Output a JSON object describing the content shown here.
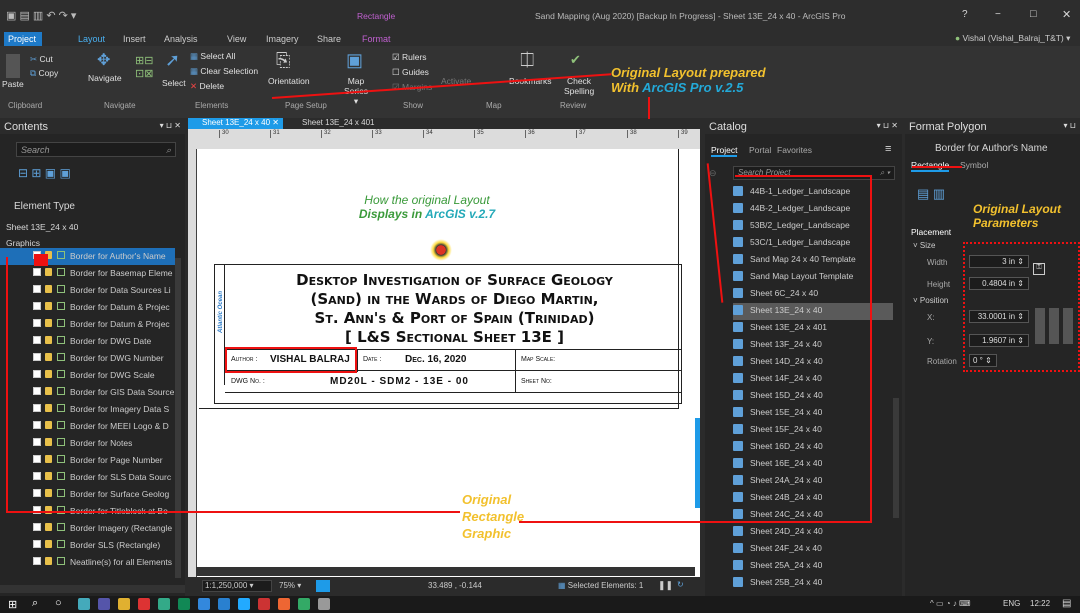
{
  "window": {
    "title_center": "Rectangle",
    "title": "Sand Mapping (Aug 2020) [Backup In Progress] - Sheet 13E_24 x 40 - ArcGIS Pro",
    "controls": [
      "?",
      "−",
      "□",
      "✕"
    ]
  },
  "tabs": [
    "Project",
    "Layout",
    "Insert",
    "Analysis",
    "View",
    "Imagery",
    "Share",
    "Format"
  ],
  "user": "Vishal (Vishal_Balraj_T&T) ▾",
  "ribbon": {
    "clipboard": {
      "paste": "Paste",
      "cut": "Cut",
      "copy": "Copy",
      "label": "Clipboard"
    },
    "navigate": {
      "navigate": "Navigate",
      "label": "Navigate"
    },
    "elements": {
      "select": "Select",
      "select_all": "Select All",
      "clear_selection": "Clear Selection",
      "delete": "Delete",
      "label": "Elements"
    },
    "page_setup": {
      "orientation": "Orientation",
      "map_series": "Map Series ▾",
      "label": "Page Setup"
    },
    "show": {
      "rulers": "Rulers",
      "guides": "Guides",
      "margins": "Margins",
      "label": "Show"
    },
    "map": {
      "activate": "Activate",
      "bookmarks": "Bookmarks",
      "label": "Map"
    },
    "review": {
      "check_spelling": "Check Spelling",
      "label": "Review"
    }
  },
  "annotations": {
    "top": "Original Layout prepared",
    "top2_prefix": "With ",
    "top2_app": "ArcGIS Pro v.2.5",
    "params1": "Original Layout",
    "params2": "Parameters",
    "rect1": "Original",
    "rect2": "Rectangle",
    "rect3": "Graphic"
  },
  "contents": {
    "title": "Contents",
    "search": "Search",
    "element_type": "Element Type",
    "sheet": "Sheet 13E_24 x 40",
    "graphics": "Graphics",
    "items": [
      "Border for Author's Name",
      "Border for Basemap Eleme",
      "Border for Data Sources Li",
      "Border for Datum & Projec",
      "Border for Datum & Projec",
      "Border for DWG Date",
      "Border for DWG Number",
      "Border for DWG Scale",
      "Border for GIS Data Source",
      "Border for Imagery Data S",
      "Border for MEEI Logo & D",
      "Border for Notes",
      "Border for Page Number",
      "Border for SLS Data Sourc",
      "Border for Surface Geolog",
      "Border for Titleblock at Bo",
      "Border Imagery (Rectangle",
      "Border SLS (Rectangle)",
      "Neatline(s) for all Elements"
    ]
  },
  "map_tabs": [
    "Sheet 13E_24 x 40",
    "Sheet 13E_24 x 401"
  ],
  "ruler": [
    "30",
    "31",
    "32",
    "33",
    "34",
    "35",
    "36",
    "37",
    "38",
    "39"
  ],
  "layout": {
    "caption1": "How the original Layout",
    "caption2_prefix": "Displays in ",
    "caption2_app": "ArcGIS v.2.7",
    "title_lines": [
      "Desktop Investigation of Surface Geology",
      "(Sand) in the Wards of Diego Martin,",
      "St. Ann's & Port of Spain (Trinidad)",
      "[ L&S Sectional Sheet 13E ]"
    ],
    "author_label": "Author :",
    "author": "VISHAL BALRAJ",
    "date_label": "Date :",
    "date": "Dec. 16, 2020",
    "map_scale": "Map Scale:",
    "dwg_label": "DWG No. :",
    "dwg": "MD20L - SDM2 - 13E - 00",
    "sheet_no": "Sheet No:",
    "side_text": "Atlantic Ocean",
    "ruler_v": "200"
  },
  "status": {
    "scale": "1:1,250,000",
    "zoom": "75%",
    "coords": "33.489 , -0.144",
    "selected": "Selected Elements: 1"
  },
  "catalog": {
    "title": "Catalog",
    "tabs": [
      "Project",
      "Portal",
      "Favorites"
    ],
    "search": "Search Project",
    "items": [
      "44B-1_Ledger_Landscape",
      "44B-2_Ledger_Landscape",
      "53B/2_Ledger_Landscape",
      "53C/1_Ledger_Landscape",
      "Sand Map 24 x 40 Template",
      "Sand Map Layout Template",
      "Sheet 6C_24 x 40",
      "Sheet 13E_24 x 40",
      "Sheet 13E_24 x 401",
      "Sheet 13F_24 x 40",
      "Sheet 14D_24 x 40",
      "Sheet 14F_24 x 40",
      "Sheet 15D_24 x 40",
      "Sheet 15E_24 x 40",
      "Sheet 15F_24 x 40",
      "Sheet 16D_24 x 40",
      "Sheet 16E_24 x 40",
      "Sheet 24A_24 x 40",
      "Sheet 24B_24 x 40",
      "Sheet 24C_24 x 40",
      "Sheet 24D_24 x 40",
      "Sheet 24F_24 x 40",
      "Sheet 25A_24 x 40",
      "Sheet 25B_24 x 40"
    ]
  },
  "format": {
    "title": "Format Polygon",
    "subtitle": "Border for Author's Name",
    "tabs": [
      "Rectangle",
      "Symbol"
    ],
    "placement": "Placement",
    "size": "Size",
    "width_label": "Width",
    "width": "3 in",
    "height_label": "Height",
    "height": "0.4804 in",
    "position": "Position",
    "x_label": "X:",
    "x": "33.0001 in",
    "y_label": "Y:",
    "y": "1.9607 in",
    "rotation_label": "Rotation",
    "rotation": "0 °"
  },
  "taskbar": {
    "lang": "ENG",
    "time": "12:22"
  },
  "colors": {
    "accent": "#1e9be8",
    "annotation": "#f2c12e",
    "red": "#ee1111",
    "teal": "#23a9b8",
    "green": "#4aa832"
  }
}
